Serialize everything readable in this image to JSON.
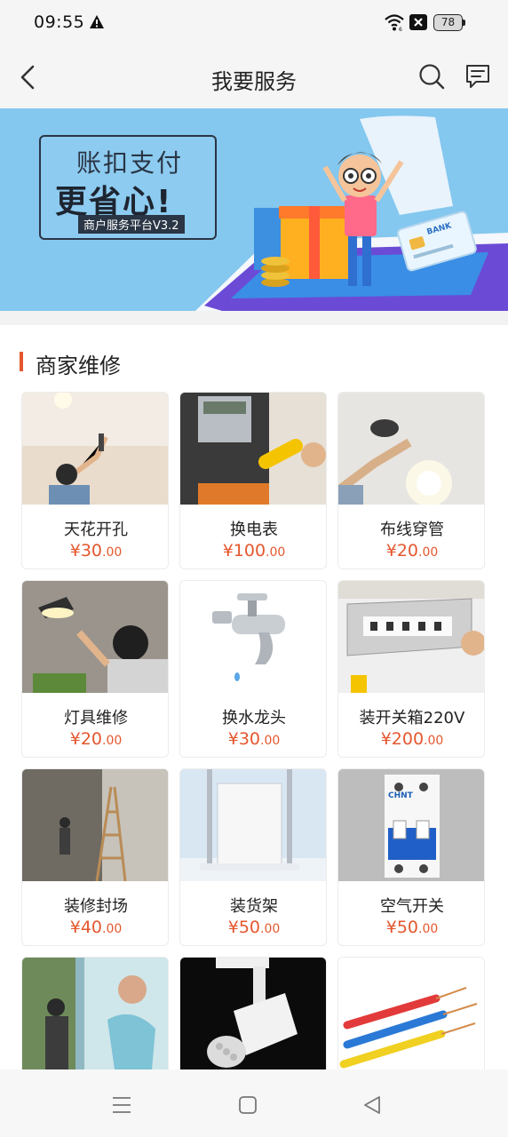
{
  "status_bar": {
    "time": "09:55",
    "battery": "78"
  },
  "header": {
    "title": "我要服务"
  },
  "banner": {
    "line1": "账扣支付",
    "line2": "更省心!",
    "tag": "商户服务平台V3.2",
    "card_text": "BANK"
  },
  "section": {
    "title": "商家维修"
  },
  "cards": [
    {
      "name": "天花开孔",
      "currency": "¥",
      "price_int": "30",
      "price_dec": ".00"
    },
    {
      "name": "换电表",
      "currency": "¥",
      "price_int": "100",
      "price_dec": ".00"
    },
    {
      "name": "布线穿管",
      "currency": "¥",
      "price_int": "20",
      "price_dec": ".00"
    },
    {
      "name": "灯具维修",
      "currency": "¥",
      "price_int": "20",
      "price_dec": ".00"
    },
    {
      "name": "换水龙头",
      "currency": "¥",
      "price_int": "30",
      "price_dec": ".00"
    },
    {
      "name": "装开关箱220V",
      "currency": "¥",
      "price_int": "200",
      "price_dec": ".00"
    },
    {
      "name": "装修封场",
      "currency": "¥",
      "price_int": "40",
      "price_dec": ".00"
    },
    {
      "name": "装货架",
      "currency": "¥",
      "price_int": "50",
      "price_dec": ".00"
    },
    {
      "name": "空气开关",
      "currency": "¥",
      "price_int": "50",
      "price_dec": ".00"
    }
  ],
  "breaker_brand": "CHNT",
  "colors": {
    "accent": "#e4572e",
    "banner_bg": "#84c7ef"
  }
}
